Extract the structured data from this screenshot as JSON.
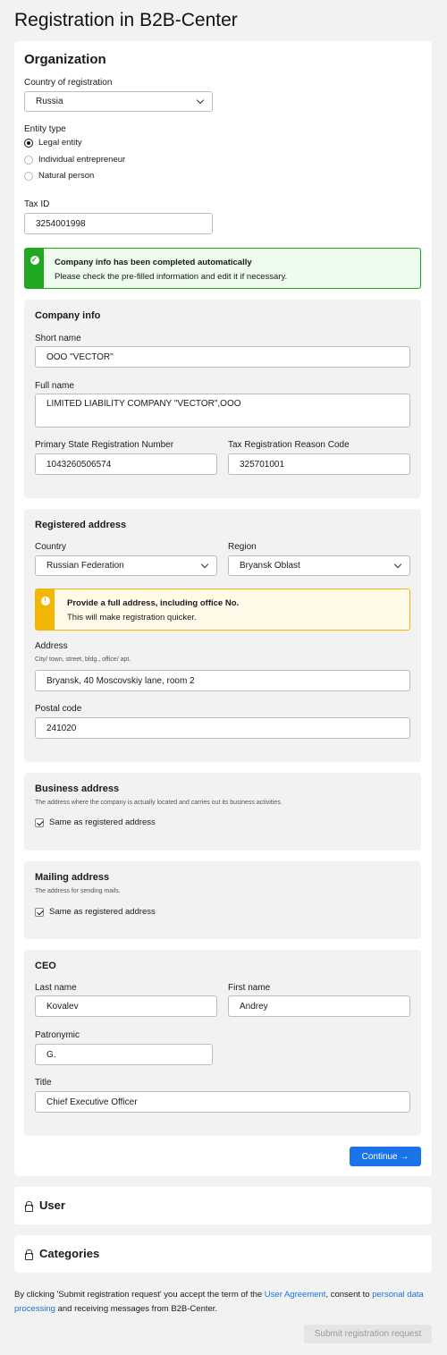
{
  "page_title": "Registration in B2B-Center",
  "organization": {
    "heading": "Organization",
    "country_label": "Country of registration",
    "country_value": "Russia",
    "entity_type_label": "Entity type",
    "entity_options": [
      "Legal entity",
      "Individual entrepreneur",
      "Natural person"
    ],
    "entity_selected": "Legal entity",
    "tax_id_label": "Tax ID",
    "tax_id_value": "3254001998"
  },
  "success_alert": {
    "title": "Company info has been completed automatically",
    "message": "Please check the pre-filled information and edit it if necessary."
  },
  "company_info": {
    "heading": "Company info",
    "short_name_label": "Short name",
    "short_name_value": "OOO \"VECTOR\"",
    "full_name_label": "Full name",
    "full_name_value": "LIMITED LIABILITY COMPANY \"VECTOR\",OOO",
    "psrn_label": "Primary State Registration Number",
    "psrn_value": "1043260506574",
    "trrc_label": "Tax Registration Reason Code",
    "trrc_value": "325701001"
  },
  "registered_address": {
    "heading": "Registered address",
    "country_label": "Country",
    "country_value": "Russian Federation",
    "region_label": "Region",
    "region_value": "Bryansk Oblast",
    "warning_title": "Provide a full address, including office No.",
    "warning_message": "This will make registration quicker.",
    "address_label": "Address",
    "address_hint": "City/ town, street, bldg., office/ apt.",
    "address_value": "Bryansk, 40 Moscovskiy lane, room 2",
    "postal_label": "Postal code",
    "postal_value": "241020"
  },
  "business_address": {
    "heading": "Business address",
    "hint": "The address where the company is actually located and carries out its business activities.",
    "checkbox_label": "Same as registered address",
    "checked": true
  },
  "mailing_address": {
    "heading": "Mailing address",
    "hint": "The address for sending mails.",
    "checkbox_label": "Same as registered address",
    "checked": true
  },
  "ceo": {
    "heading": "CEO",
    "last_name_label": "Last name",
    "last_name_value": "Kovalev",
    "first_name_label": "First name",
    "first_name_value": "Andrey",
    "patronymic_label": "Patronymic",
    "patronymic_value": "G.",
    "title_label": "Title",
    "title_value": "Chief Executive Officer"
  },
  "continue_button": "Continue →",
  "user_section": "User",
  "categories_section": "Categories",
  "footer": {
    "text_1": "By clicking 'Submit registration request' you accept the term of the ",
    "link_1": "User Agreement",
    "text_2": ", consent to ",
    "link_2": "personal data processing",
    "text_3": " and receiving messages from B2B-Center."
  },
  "submit_button": "Submit registration request",
  "colors": {
    "accent": "#1a73e8",
    "success": "#21a821",
    "warning": "#f2b705",
    "background": "#f2f2f2"
  }
}
